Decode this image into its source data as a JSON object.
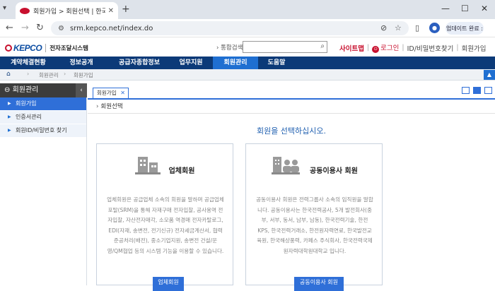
{
  "browser": {
    "tab_title": "회원가입 > 회원선택 | 한국전력",
    "tab_favicon": "KEPCO",
    "url": "srm.kepco.net/index.do",
    "update_button": "업데이트 완료 :",
    "avatar_initial": "●"
  },
  "header": {
    "logo_text": "KEPCO",
    "system_name": "전자조달시스템",
    "search_label": "통합검색",
    "search_placeholder": "",
    "sitemap": "사이트맵",
    "login": "로그인",
    "find_id": "ID/비밀번호찾기",
    "join": "회원가입"
  },
  "gnb": [
    "계약체결현황",
    "정보공개",
    "공급자종합정보",
    "업무지원",
    "회원관리",
    "도움말"
  ],
  "breadcrumb": {
    "level1": "회원관리",
    "level2": "회원가입"
  },
  "sidebar": {
    "title": "회원관리",
    "items": [
      "회원가입",
      "인증서관리",
      "회원ID/비밀번호 찾기"
    ]
  },
  "content": {
    "tab_label": "회원가입",
    "section_title": "회원선택",
    "prompt": "회원을 선택하십시오.",
    "cards": [
      {
        "title": "업체회원",
        "desc": "업체회원은 공급업체 소속의 회원을 말하며 공급업체 포탈(SRM)을 통해 자재구매 전자입찰, 공사용역 전자입찰, 자산전자매각, 소모품 역경매 전자카탈로그, EDI(자재, 송변전, 전기신규) 전자세금계산서, 협력준공처리(배전), 중소기업지원, 송변전 건설/운영/QM협업 등의 시스템 기능을 이용할 수 있습니다.",
        "button": "업체회원"
      },
      {
        "title": "공동이용사 회원",
        "desc": "공동이용사 회원은 전력그룹사 소속의 임직원을 말합니다. 공동이용사는 한국전력공사, 5개 발전회사(중부, 서부, 동서, 남부, 남동), 한국전력기술, 한전KPS, 한국전력거래소, 한전원자력연료, 한국발전교육원, 한국해상풍력, 카페스 주식회사, 한국전력국제원자력대학원대학교 입니다.",
        "button": "공동이용사 회원"
      }
    ]
  },
  "colors": {
    "navy": "#0c3a78",
    "accent": "#2f6fd8",
    "brand_red": "#c8102e"
  }
}
